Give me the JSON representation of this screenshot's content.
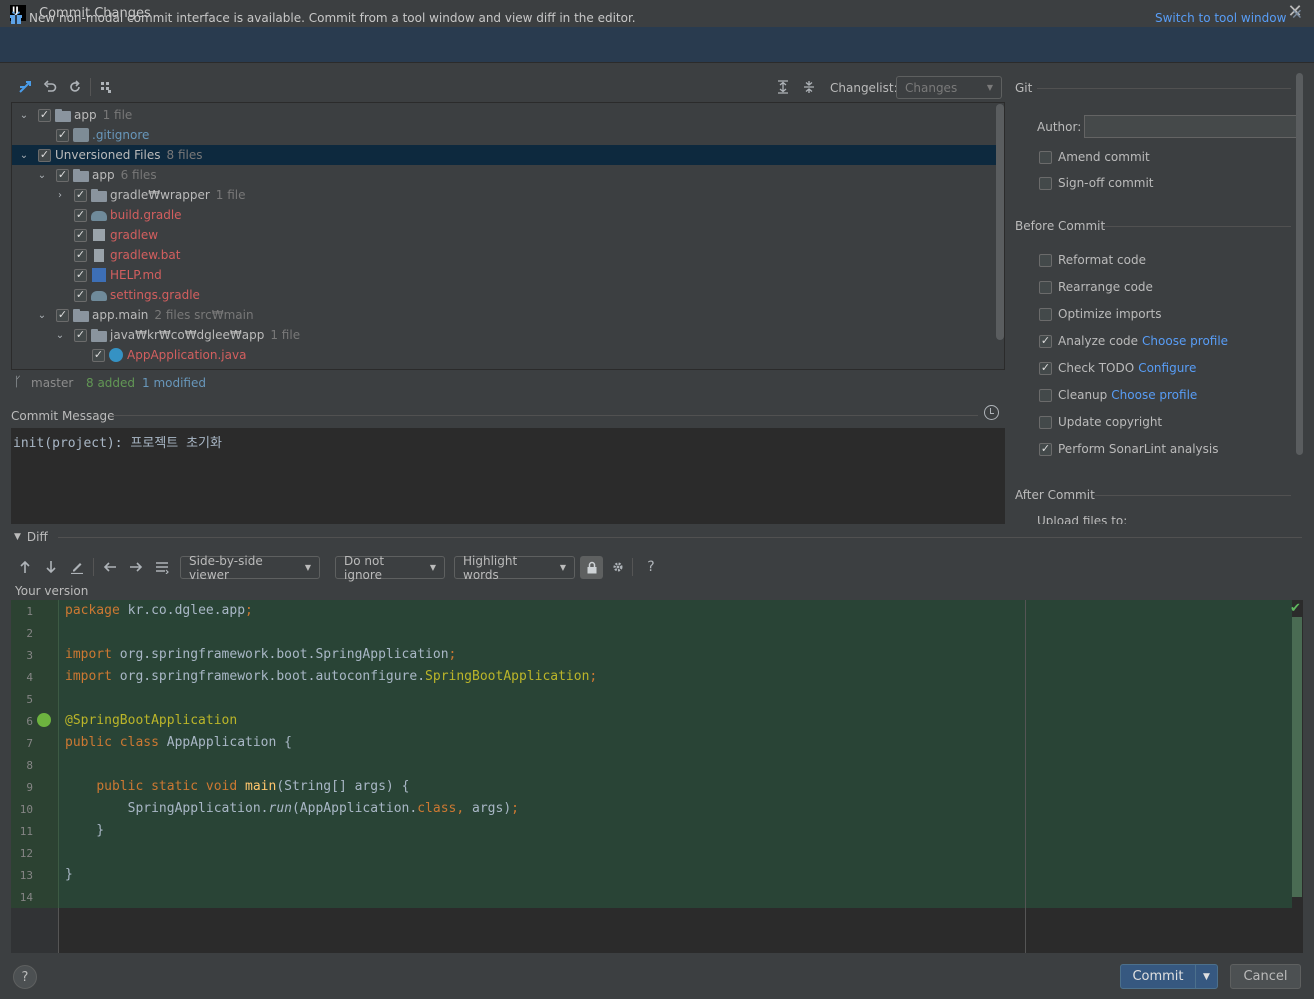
{
  "window": {
    "title": "Commit Changes",
    "close_glyph": "✕"
  },
  "banner": {
    "text": "New non-modal commit interface is available. Commit from a tool window and view diff in the editor.",
    "link": "Switch to tool window",
    "close_glyph": "✕"
  },
  "toolbar": {
    "changelist_label": "Changelist:",
    "changelist_value": "Changes"
  },
  "tree": {
    "rows": [
      {
        "name": "app",
        "count": "1 file",
        "color": "white"
      },
      {
        "name": ".gitignore",
        "count": "",
        "color": "blue"
      },
      {
        "name": "Unversioned Files",
        "count": "8 files",
        "color": "white"
      },
      {
        "name": "app",
        "count": "6 files",
        "color": "white"
      },
      {
        "name": "gradle₩wrapper",
        "count": "1 file",
        "color": "white"
      },
      {
        "name": "build.gradle",
        "count": "",
        "color": "red"
      },
      {
        "name": "gradlew",
        "count": "",
        "color": "red"
      },
      {
        "name": "gradlew.bat",
        "count": "",
        "color": "red"
      },
      {
        "name": "HELP.md",
        "count": "",
        "color": "red"
      },
      {
        "name": "settings.gradle",
        "count": "",
        "color": "red"
      },
      {
        "name": "app.main",
        "count": "2 files  src₩main",
        "color": "white"
      },
      {
        "name": "java₩kr₩co₩dglee₩app",
        "count": "1 file",
        "color": "white"
      },
      {
        "name": "AppApplication.java",
        "count": "",
        "color": "red"
      }
    ]
  },
  "status": {
    "branch": "master",
    "added": "8 added",
    "modified": "1 modified"
  },
  "commit_message": {
    "label": "Commit Message",
    "text": "init(project): 프로젝트 초기화"
  },
  "right_panel": {
    "git_title": "Git",
    "author_label": "Author:",
    "author_value": "",
    "amend": "Amend commit",
    "signoff": "Sign-off commit",
    "before_commit_title": "Before Commit",
    "options": [
      {
        "label": "Reformat code",
        "checked": false,
        "link": ""
      },
      {
        "label": "Rearrange code",
        "checked": false,
        "link": ""
      },
      {
        "label": "Optimize imports",
        "checked": false,
        "link": ""
      },
      {
        "label": "Analyze code",
        "checked": true,
        "link": "Choose profile"
      },
      {
        "label": "Check TODO",
        "checked": true,
        "link": "Configure"
      },
      {
        "label": "Cleanup",
        "checked": false,
        "link": "Choose profile"
      },
      {
        "label": "Update copyright",
        "checked": false,
        "link": ""
      },
      {
        "label": "Perform SonarLint analysis",
        "checked": true,
        "link": ""
      }
    ],
    "after_commit_title": "After Commit",
    "after_commit_cut": "Upload files to:"
  },
  "diff": {
    "title": "Diff",
    "viewer": "Side-by-side viewer",
    "ignore": "Do not ignore",
    "highlight": "Highlight words",
    "help_glyph": "?",
    "your_version": "Your version",
    "line_numbers": [
      "1",
      "2",
      "3",
      "4",
      "5",
      "6",
      "7",
      "8",
      "9",
      "10",
      "11",
      "12",
      "13",
      "14"
    ]
  },
  "footer": {
    "help_glyph": "?",
    "commit": "Commit",
    "cancel": "Cancel"
  },
  "colors": {
    "bg": "#3c3f41",
    "banner": "#293b4f",
    "link": "#589df6",
    "added_green": "#294436",
    "keyword": "#cc7832",
    "annotation": "#bbb529",
    "unversioned": "#d35f5f",
    "modified": "#6897bb",
    "commit_button": "#365880"
  }
}
